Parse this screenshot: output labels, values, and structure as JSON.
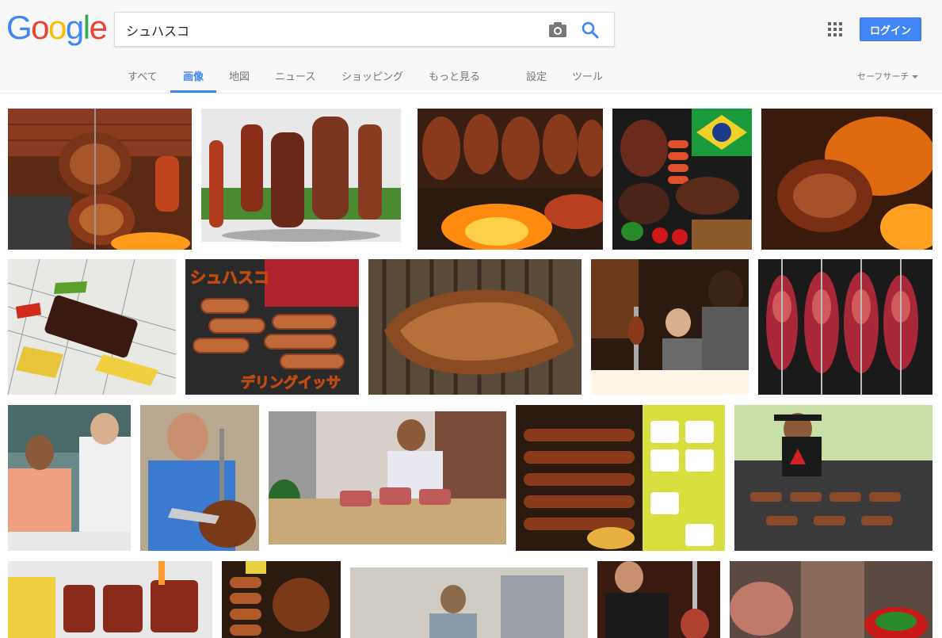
{
  "logo": {
    "letters": [
      "G",
      "o",
      "o",
      "g",
      "l",
      "e"
    ],
    "colors": [
      "#4285f4",
      "#ea4335",
      "#fbbc05",
      "#4285f4",
      "#34a853",
      "#ea4335"
    ]
  },
  "search": {
    "query": "シュハスコ"
  },
  "header": {
    "login_label": "ログイン"
  },
  "tabs": {
    "all": "すべて",
    "images": "画像",
    "maps": "地図",
    "news": "ニュース",
    "shopping": "ショッピング",
    "more": "もっと見る",
    "settings": "設定",
    "tools": "ツール"
  },
  "safesearch": {
    "label": "セーフサーチ"
  },
  "images": {
    "r2c2_text1": "シュハスコ",
    "r2c2_text2": "デリングイッサ"
  },
  "colors": {
    "accent": "#4285f4",
    "header_bg": "#f8f8f8",
    "tab_text": "#777777"
  }
}
